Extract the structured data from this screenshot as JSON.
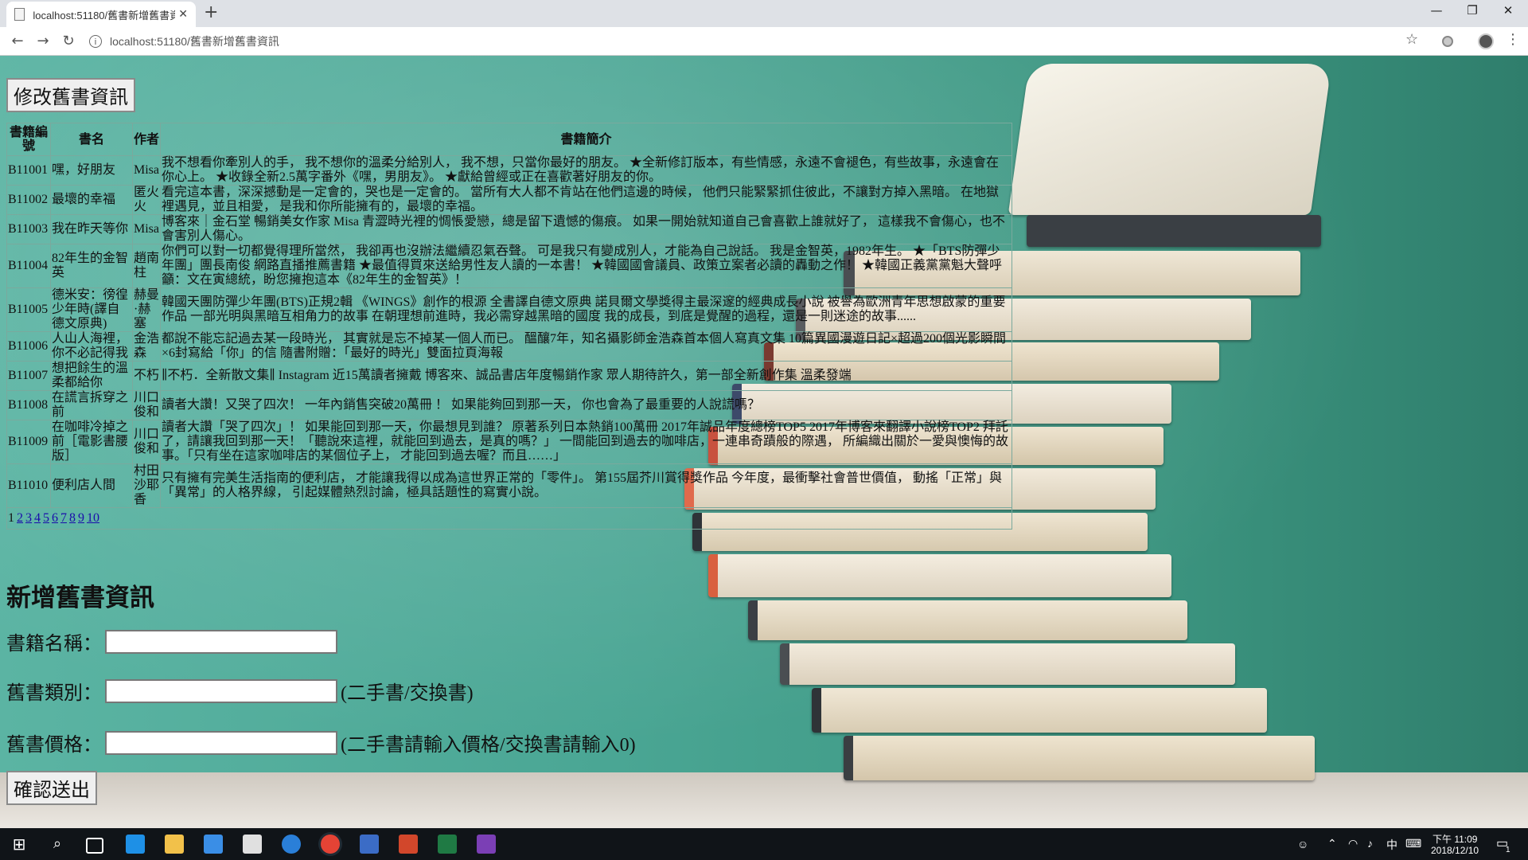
{
  "browser": {
    "tab_title": "localhost:51180/舊書新增舊書資",
    "tab_close": "✕",
    "new_tab": "+",
    "url": "localhost:51180/舊書新增舊書資訊",
    "window_controls": [
      "—",
      "❐",
      "✕"
    ]
  },
  "page": {
    "edit_button": "修改舊書資訊",
    "table": {
      "headers": [
        "書籍編號",
        "書名",
        "作者",
        "書籍簡介"
      ],
      "rows": [
        [
          "B11001",
          "嘿，好朋友",
          "Misa",
          "我不想看你牽別人的手， 我不想你的溫柔分給別人， 我不想，只當你最好的朋友。 ★全新修訂版本，有些情感，永遠不會褪色，有些故事，永遠會在你心上。 ★收錄全新2.5萬字番外《嘿，男朋友》。 ★獻給曾經或正在喜歡著好朋友的你。"
        ],
        [
          "B11002",
          "最壞的幸福",
          "匿火火",
          "看完這本書，深深撼動是一定會的，哭也是一定會的。 當所有大人都不肯站在他們這邊的時候， 他們只能緊緊抓住彼此，不讓對方掉入黑暗。 在地獄裡遇見，並且相愛， 是我和你所能擁有的，最壞的幸福。"
        ],
        [
          "B11003",
          "我在昨天等你",
          "Misa",
          "博客來｜金石堂 暢銷美女作家 Misa 青澀時光裡的惆悵愛戀，總是留下遺憾的傷痕。 如果一開始就知道自己會喜歡上誰就好了， 這樣我不會傷心，也不會害別人傷心。"
        ],
        [
          "B11004",
          "82年生的金智英",
          "趙南柱",
          "你們可以對一切都覺得理所當然， 我卻再也沒辦法繼續忍氣吞聲。 可是我只有變成別人，才能為自己說話。 我是金智英，1982年生。 ★「BTS防彈少年團」團長南俊 網路直播推薦書籍 ★最值得買來送給男性友人讀的一本書！ ★韓國國會議員、政策立案者必讀的轟動之作！ ★韓國正義黨黨魁大聲呼籲：文在寅總統，盼您擁抱這本《82年生的金智英》！"
        ],
        [
          "B11005",
          "德米安：徬徨少年時(譯自德文原典)",
          "赫曼·赫塞",
          "韓國天團防彈少年團(BTS)正規2輯 《WINGS》創作的根源 全書譯自德文原典 諾貝爾文學獎得主最深邃的經典成長小說 被譽為歐洲青年思想啟蒙的重要作品 一部光明與黑暗互相角力的故事 在朝理想前進時，我必需穿越黑暗的國度 我的成長，到底是覺醒的過程，還是一則迷途的故事......"
        ],
        [
          "B11006",
          "人山人海裡，你不必記得我",
          "金浩森",
          "都說不能忘記過去某一段時光， 其實就是忘不掉某一個人而已。 醞釀7年，知名攝影師金浩森首本個人寫真文集 10篇異國漫遊日記×超過200個光影瞬間×6封寫給「你」的信 隨書附贈：「最好的時光」雙面拉頁海報"
        ],
        [
          "B11007",
          "想把餘生的溫柔都給你",
          "不朽",
          "∥不朽．全新散文集∥ Instagram 近15萬讀者擁戴 博客來、誠品書店年度暢銷作家 眾人期待許久，第一部全新創作集 溫柔發端"
        ],
        [
          "B11008",
          "在謊言拆穿之前",
          "川口俊和",
          "讀者大讚！又哭了四次！ 一年內銷售突破20萬冊 ！ 如果能夠回到那一天， 你也會為了最重要的人說謊嗎？"
        ],
        [
          "B11009",
          "在咖啡冷掉之前［電影書腰版］",
          "川口俊和",
          "讀者大讚「哭了四次」！ 如果能回到那一天，你最想見到誰？ 原著系列日本熱銷100萬冊 2017年誠品年度總榜TOP5 2017年博客來翻譯小說榜TOP2 拜託了，請讓我回到那一天！「聽說來這裡，就能回到過去，是真的嗎？」 一間能回到過去的咖啡店，一連串奇蹟般的際遇， 所編織出關於一愛與懊悔的故事。「只有坐在這家咖啡店的某個位子上， 才能回到過去喔？而且……」"
        ],
        [
          "B11010",
          "便利店人間",
          "村田沙耶香",
          "只有擁有完美生活指南的便利店， 才能讓我得以成為這世界正常的「零件」。 第155屆芥川賞得獎作品 今年度，最衝擊社會普世價值， 動搖「正常」與「異常」的人格界線， 引起媒體熱烈討論，極具話題性的寫實小說。"
        ]
      ],
      "pager": {
        "current": "1",
        "pages": [
          "2",
          "3",
          "4",
          "5",
          "6",
          "7",
          "8",
          "9",
          "10"
        ]
      }
    },
    "form": {
      "title": "新增舊書資訊",
      "name_label": "書籍名稱：",
      "name_value": "",
      "type_label": "舊書類別：",
      "type_value": "",
      "type_hint": "(二手書/交換書)",
      "price_label": "舊書價格：",
      "price_value": "",
      "price_hint": "(二手書請輸入價格/交換書請輸入0)",
      "submit_label": "確認送出"
    }
  },
  "taskbar": {
    "time": "下午 11:09",
    "date": "2018/12/10",
    "ime": "中",
    "notification_count": "1"
  },
  "colors": {
    "chalkboard": "#4aa694",
    "link": "#1a0dab",
    "taskbar": "#101418"
  }
}
